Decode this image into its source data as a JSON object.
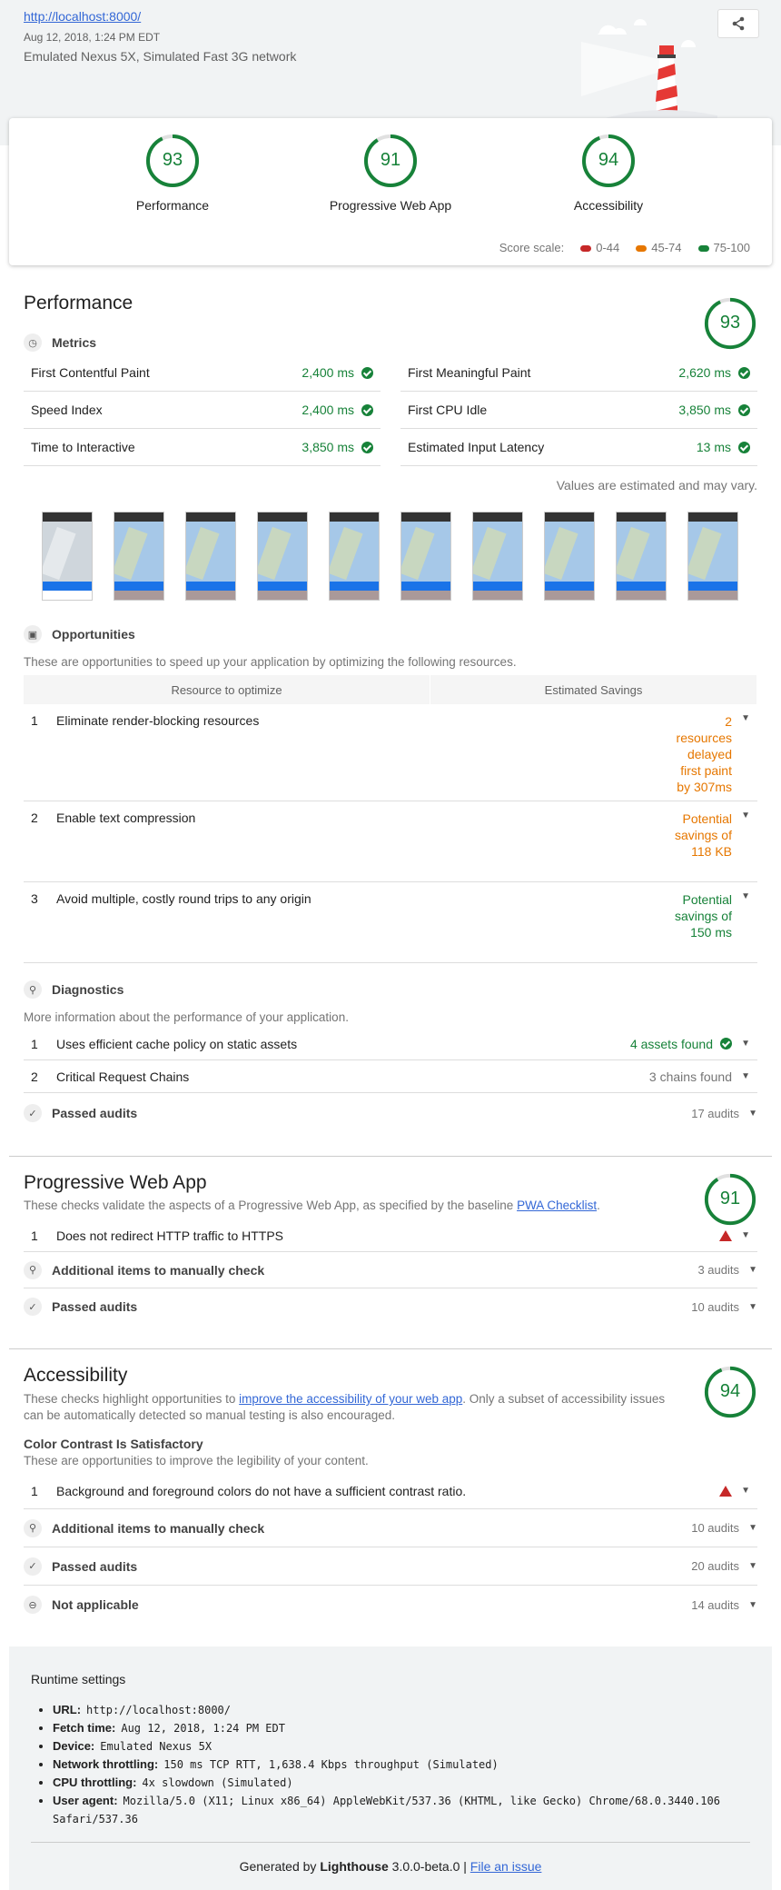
{
  "header": {
    "url": "http://localhost:8000/",
    "fetch_time": "Aug 12, 2018, 1:24 PM EDT",
    "environment": "Emulated Nexus 5X, Simulated Fast 3G network"
  },
  "summary": {
    "gauges": [
      {
        "score": "93",
        "label": "Performance",
        "fraction": 0.93
      },
      {
        "score": "91",
        "label": "Progressive Web App",
        "fraction": 0.91
      },
      {
        "score": "94",
        "label": "Accessibility",
        "fraction": 0.94
      }
    ],
    "scale_label": "Score scale:",
    "scale": [
      {
        "range": "0-44",
        "color": "#c62828"
      },
      {
        "range": "45-74",
        "color": "#e67700"
      },
      {
        "range": "75-100",
        "color": "#178239"
      }
    ]
  },
  "colors": {
    "pass": "#178239",
    "average": "#e67700",
    "fail": "#c62828",
    "link": "#3367d6"
  },
  "performance": {
    "title": "Performance",
    "score": "93",
    "metrics_label": "Metrics",
    "metrics": [
      {
        "name": "First Contentful Paint",
        "value": "2,400 ms"
      },
      {
        "name": "First Meaningful Paint",
        "value": "2,620 ms"
      },
      {
        "name": "Speed Index",
        "value": "2,400 ms"
      },
      {
        "name": "First CPU Idle",
        "value": "3,850 ms"
      },
      {
        "name": "Time to Interactive",
        "value": "3,850 ms"
      },
      {
        "name": "Estimated Input Latency",
        "value": "13 ms"
      }
    ],
    "estimate_note": "Values are estimated and may vary.",
    "opportunities_label": "Opportunities",
    "opportunities_desc": "These are opportunities to speed up your application by optimizing the following resources.",
    "col_resource": "Resource to optimize",
    "col_savings": "Estimated Savings",
    "opportunities": [
      {
        "n": "1",
        "title": "Eliminate render-blocking resources",
        "savings": "2 resources delayed first paint by 307ms"
      },
      {
        "n": "2",
        "title": "Enable text compression",
        "savings": "Potential savings of 118 KB"
      },
      {
        "n": "3",
        "title": "Avoid multiple, costly round trips to any origin",
        "savings": "Potential savings of 150 ms"
      }
    ],
    "diagnostics_label": "Diagnostics",
    "diagnostics_desc": "More information about the performance of your application.",
    "diagnostics": [
      {
        "n": "1",
        "title": "Uses efficient cache policy on static assets",
        "result": "4 assets found"
      },
      {
        "n": "2",
        "title": "Critical Request Chains",
        "result": "3 chains found"
      }
    ],
    "passed_label": "Passed audits",
    "passed_count": "17 audits"
  },
  "pwa": {
    "title": "Progressive Web App",
    "score": "91",
    "desc_prefix": "These checks validate the aspects of a Progressive Web App, as specified by the baseline ",
    "desc_link": "PWA Checklist",
    "desc_suffix": ".",
    "failed": {
      "n": "1",
      "title": "Does not redirect HTTP traffic to HTTPS"
    },
    "manual_label": "Additional items to manually check",
    "manual_count": "3 audits",
    "passed_label": "Passed audits",
    "passed_count": "10 audits"
  },
  "a11y": {
    "title": "Accessibility",
    "score": "94",
    "desc_prefix": "These checks highlight opportunities to ",
    "desc_link": "improve the accessibility of your web app",
    "desc_suffix": ". Only a subset of accessibility issues can be automatically detected so manual testing is also encouraged.",
    "group_title": "Color Contrast Is Satisfactory",
    "group_desc": "These are opportunities to improve the legibility of your content.",
    "failed": {
      "n": "1",
      "title": "Background and foreground colors do not have a sufficient contrast ratio."
    },
    "manual_label": "Additional items to manually check",
    "manual_count": "10 audits",
    "passed_label": "Passed audits",
    "passed_count": "20 audits",
    "na_label": "Not applicable",
    "na_count": "14 audits"
  },
  "runtime": {
    "title": "Runtime settings",
    "items": [
      {
        "key": "URL:",
        "value": "http://localhost:8000/"
      },
      {
        "key": "Fetch time:",
        "value": "Aug 12, 2018, 1:24 PM EDT"
      },
      {
        "key": "Device:",
        "value": "Emulated Nexus 5X"
      },
      {
        "key": "Network throttling:",
        "value": "150 ms TCP RTT, 1,638.4 Kbps throughput (Simulated)"
      },
      {
        "key": "CPU throttling:",
        "value": "4x slowdown (Simulated)"
      },
      {
        "key": "User agent:",
        "value": "Mozilla/5.0 (X11; Linux x86_64) AppleWebKit/537.36 (KHTML, like Gecko) Chrome/68.0.3440.106 Safari/537.36"
      }
    ]
  },
  "footer": {
    "prefix": "Generated by ",
    "product": "Lighthouse",
    "version": " 3.0.0-beta.0 | ",
    "link": "File an issue"
  }
}
